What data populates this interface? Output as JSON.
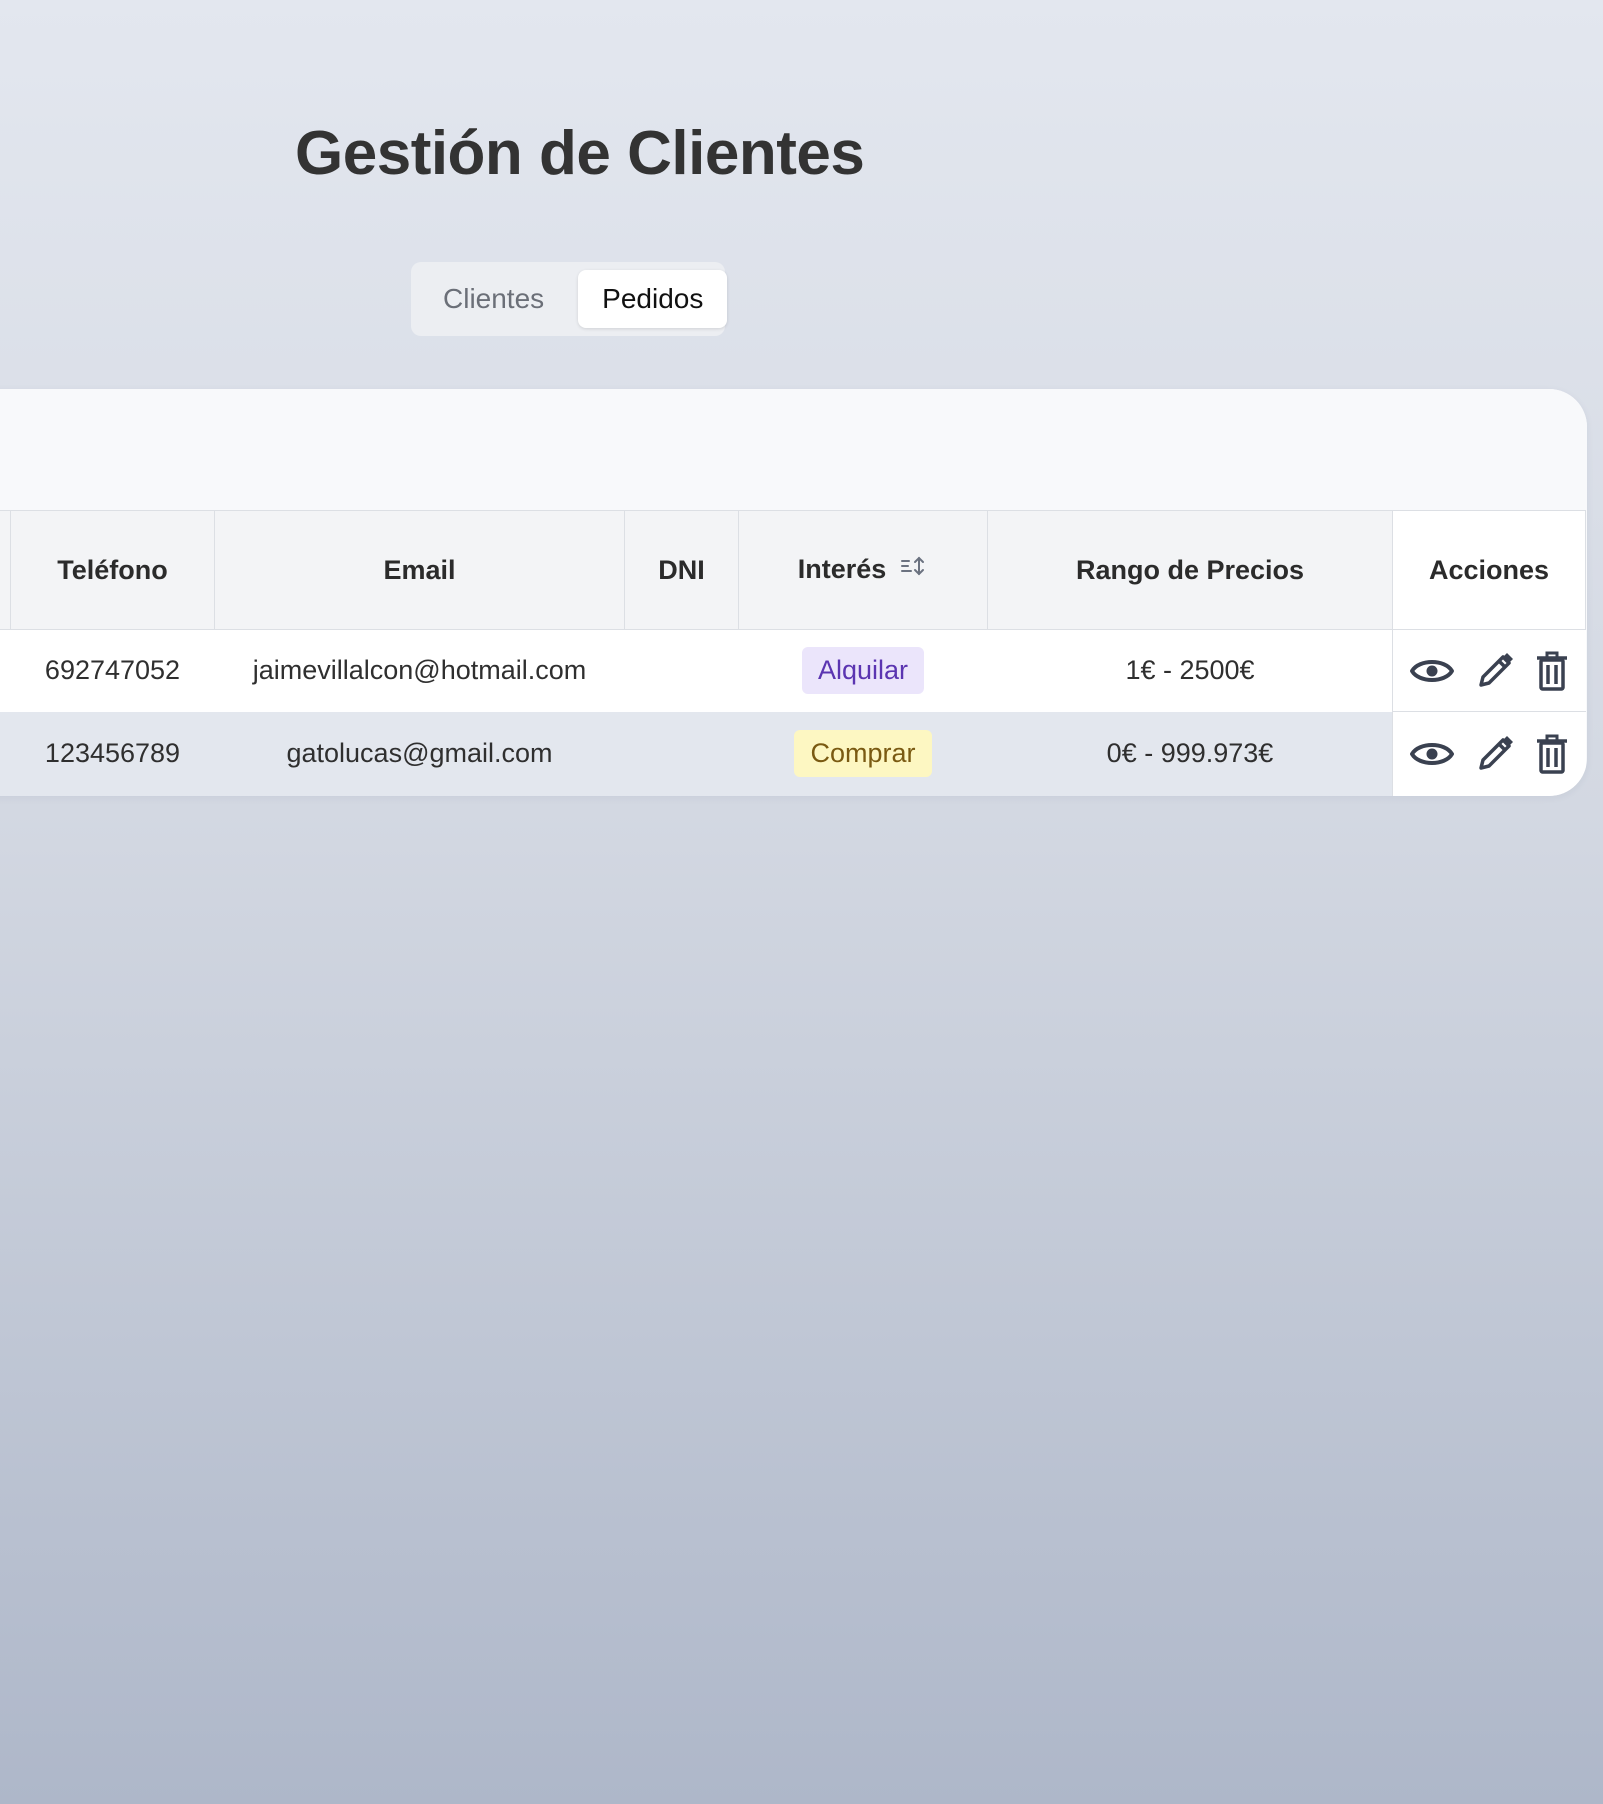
{
  "page": {
    "title": "Gestión de Clientes"
  },
  "tabs": [
    {
      "label": "Clientes",
      "active": false
    },
    {
      "label": "Pedidos",
      "active": true
    }
  ],
  "table": {
    "columns": [
      "",
      "Teléfono",
      "Email",
      "DNI",
      "Interés",
      "Rango de Precios",
      "Acciones"
    ],
    "rows": [
      {
        "telefono": "692747052",
        "email": "jaimevillalcon@hotmail.com",
        "dni": "",
        "interes": "Alquilar",
        "rango": "1€ - 2500€"
      },
      {
        "telefono": "123456789",
        "email": "gatolucas@gmail.com",
        "dni": "",
        "interes": "Comprar",
        "rango": "0€ - 999.973€"
      }
    ],
    "sort_icon": "sort-icon",
    "action_icons": [
      "eye-icon",
      "pencil-icon",
      "trash-icon"
    ]
  },
  "colors": {
    "alquilar_bg": "#ebe5fb",
    "alquilar_text": "#5b35b1",
    "comprar_bg": "#fdf7c2",
    "comprar_text": "#7a5a12",
    "icon": "#3a4150"
  }
}
